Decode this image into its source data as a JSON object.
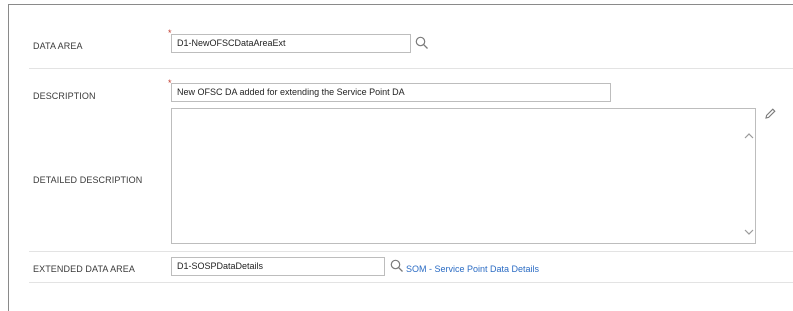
{
  "form": {
    "data_area": {
      "label": "DATA AREA",
      "required_marker": "*",
      "value": "D1-NewOFSCDataAreaExt",
      "search_icon": "search-icon"
    },
    "description": {
      "label": "DESCRIPTION",
      "required_marker": "*",
      "value": "New OFSC DA added for extending the Service Point DA"
    },
    "detailed_description": {
      "label": "DETAILED DESCRIPTION",
      "value": "",
      "edit_icon": "pencil-icon",
      "scroll_up_icon": "chevron-up-icon",
      "scroll_down_icon": "chevron-down-icon"
    },
    "extended_data_area": {
      "label": "EXTENDED DATA AREA",
      "value": "D1-SOSPDataDetails",
      "search_icon": "search-icon",
      "link_text": "SOM - Service Point Data Details"
    }
  },
  "colors": {
    "label": "#3a3a3a",
    "link": "#2b6cc4",
    "required": "#c0392b",
    "border": "#bdbdbd"
  }
}
